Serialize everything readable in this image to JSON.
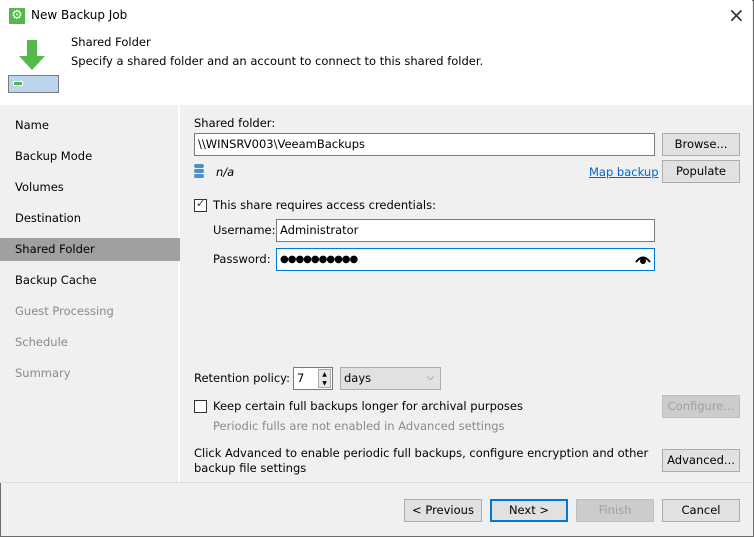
{
  "window": {
    "title": "New Backup Job",
    "close_icon": "×"
  },
  "header": {
    "title": "Shared Folder",
    "subtitle": "Specify a shared folder and an account to connect to this shared folder."
  },
  "sidebar": {
    "items": [
      {
        "label": "Name",
        "state": "normal"
      },
      {
        "label": "Backup Mode",
        "state": "normal"
      },
      {
        "label": "Volumes",
        "state": "normal"
      },
      {
        "label": "Destination",
        "state": "normal"
      },
      {
        "label": "Shared Folder",
        "state": "selected"
      },
      {
        "label": "Backup Cache",
        "state": "normal"
      },
      {
        "label": "Guest Processing",
        "state": "disabled"
      },
      {
        "label": "Schedule",
        "state": "disabled"
      },
      {
        "label": "Summary",
        "state": "disabled"
      }
    ]
  },
  "main": {
    "shared_folder_label": "Shared folder:",
    "shared_folder_value": "\\\\WINSRV003\\VeeamBackups",
    "browse_label": "Browse...",
    "capacity_value": "n/a",
    "map_backup_label": "Map backup",
    "populate_label": "Populate",
    "credentials_label": "This share requires access credentials:",
    "credentials_checked": true,
    "username_label": "Username:",
    "username_value": "Administrator",
    "password_label": "Password:",
    "password_value": "●●●●●●●●●●",
    "retention_label": "Retention policy:",
    "retention_value": "7",
    "retention_unit": "days",
    "archival_label": "Keep certain full backups longer for archival purposes",
    "archival_checked": false,
    "configure_label": "Configure...",
    "periodic_note": "Periodic fulls are not enabled in Advanced settings",
    "advanced_text": "Click Advanced to enable periodic full backups, configure encryption and other backup file settings",
    "advanced_label": "Advanced..."
  },
  "footer": {
    "previous": "< Previous",
    "next": "Next >",
    "finish": "Finish",
    "cancel": "Cancel"
  },
  "colors": {
    "accent": "#0078d7",
    "link": "#0066cc",
    "brand_green": "#54b948"
  }
}
